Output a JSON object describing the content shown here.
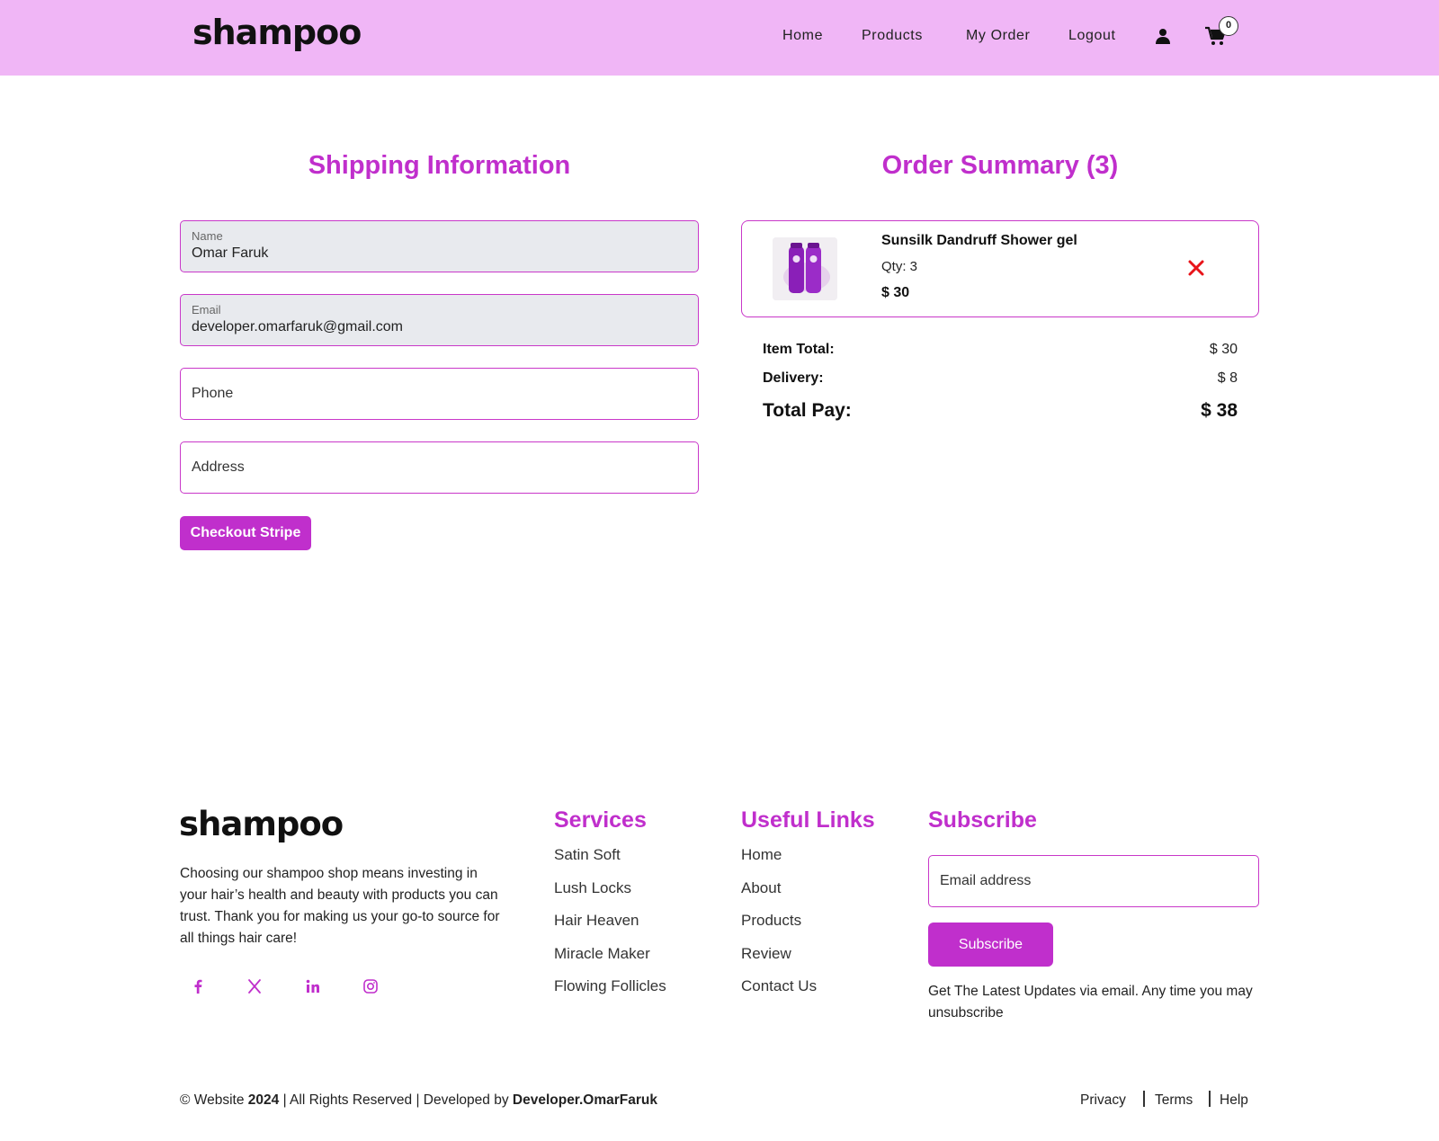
{
  "header": {
    "logo": "shampoo",
    "nav": [
      "Home",
      "Products",
      "My Order",
      "Logout"
    ],
    "cart_count": "0"
  },
  "shipping": {
    "title": "Shipping Information",
    "name_label": "Name",
    "name_value": "Omar Faruk",
    "email_label": "Email",
    "email_value": "developer.omarfaruk@gmail.com",
    "phone_placeholder": "Phone",
    "address_placeholder": "Address",
    "checkout_label": "Checkout Stripe"
  },
  "summary": {
    "title": "Order Summary (3)",
    "item": {
      "name": "Sunsilk Dandruff Shower gel",
      "qty": "Qty: 3",
      "price": "$ 30"
    },
    "item_total_label": "Item Total:",
    "item_total_value": "$ 30",
    "delivery_label": "Delivery:",
    "delivery_value": "$ 8",
    "total_label": "Total Pay:",
    "total_value": "$ 38"
  },
  "footer": {
    "logo": "shampoo",
    "description": "Choosing our shampoo shop means investing in your hair’s health and beauty with products you can trust. Thank you for making us your go-to source for all things hair care!",
    "services_heading": "Services",
    "services": [
      "Satin Soft",
      "Lush Locks",
      "Hair Heaven",
      "Miracle Maker",
      "Flowing Follicles"
    ],
    "links_heading": "Useful Links",
    "links": [
      "Home",
      "About",
      "Products",
      "Review",
      "Contact Us"
    ],
    "subscribe_heading": "Subscribe",
    "subscribe_placeholder": "Email address",
    "subscribe_button": "Subscribe",
    "subscribe_note": "Get The Latest Updates via email. Any time you may unsubscribe",
    "copyright_prefix": "© Website",
    "copyright_year": "2024",
    "copyright_mid": "| All Rights Reserved | Developed by",
    "copyright_dev": "Developer.OmarFaruk",
    "legal": [
      "Privacy",
      "Terms",
      "Help"
    ]
  },
  "colors": {
    "header_bg": "#f0b6f6",
    "accent": "#c02fcc",
    "remove": "#e8141a"
  }
}
